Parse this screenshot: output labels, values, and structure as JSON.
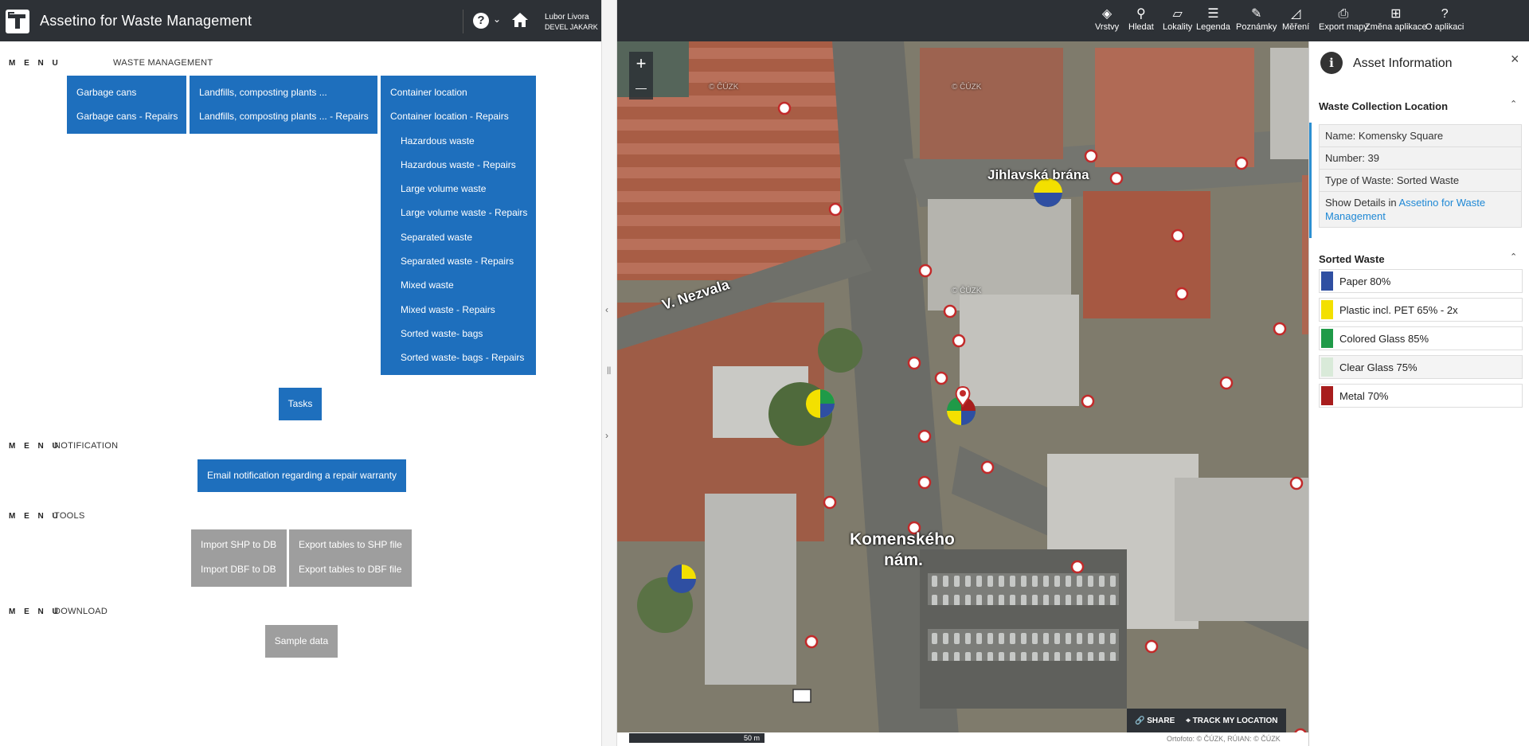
{
  "app": {
    "title": "Assetino for Waste Management",
    "user_name": "Lubor Livora",
    "user_org": "DEVEL JAKARK",
    "help_symbol": "?",
    "caret_symbol": "⌄"
  },
  "menu_tag": "M E N U",
  "sections": {
    "waste_management": {
      "label": "WASTE MANAGEMENT",
      "col1": [
        "Garbage cans",
        "Garbage cans - Repairs"
      ],
      "col2": [
        "Landfills, composting plants ...",
        "Landfills, composting plants ... - Repairs"
      ],
      "col3": [
        "Container location",
        "Container location - Repairs",
        "Hazardous waste",
        "Hazardous waste - Repairs",
        "Large volume waste",
        "Large volume waste - Repairs",
        "Separated waste",
        "Separated waste - Repairs",
        "Mixed waste",
        "Mixed waste - Repairs",
        "Sorted waste- bags",
        "Sorted waste- bags - Repairs"
      ],
      "tasks": "Tasks"
    },
    "notification": {
      "label": "NOTIFICATION",
      "email_button": "Email notification regarding a repair warranty"
    },
    "tools": {
      "label": "TOOLS",
      "col1": [
        "Import SHP to DB",
        "Import DBF to DB"
      ],
      "col2": [
        "Export tables to SHP file",
        "Export tables to DBF file"
      ]
    },
    "download": {
      "label": "DOWNLOAD",
      "sample": "Sample data"
    }
  },
  "map_toolbar": [
    {
      "label": "Vrstvy",
      "icon": "layers-icon",
      "glyph": "◈"
    },
    {
      "label": "Hledat",
      "icon": "search-icon",
      "glyph": "⚲"
    },
    {
      "label": "Lokality",
      "icon": "polygon-icon",
      "glyph": "▱"
    },
    {
      "label": "Legenda",
      "icon": "list-icon",
      "glyph": "☰"
    },
    {
      "label": "Poznámky",
      "icon": "pencil-icon",
      "glyph": "✎"
    },
    {
      "label": "Měření",
      "icon": "ruler-icon",
      "glyph": "◿"
    },
    {
      "label": "Export mapy",
      "icon": "printer-icon",
      "glyph": "⎙"
    },
    {
      "label": "Změna aplikace",
      "icon": "grid-icon",
      "glyph": "⊞"
    },
    {
      "label": "O aplikaci",
      "icon": "help-icon",
      "glyph": "?"
    }
  ],
  "map": {
    "zoom_in": "+",
    "zoom_out": "—",
    "labels": {
      "jihlavska": "Jihlavská brána",
      "nezvala": "V. Nezvala",
      "komenskeho_1": "Komenského",
      "komenskeho_2": "nám."
    },
    "watermark": "© ČÚZK",
    "scale": "50 m",
    "attribution": "Ortofoto: © ČÚZK, RÚIAN: © ČÚZK",
    "share": "SHARE",
    "track": "TRACK MY LOCATION"
  },
  "asset_panel": {
    "title": "Asset Information",
    "close": "×",
    "info_glyph": "i",
    "location_title": "Waste Collection Location",
    "name": "Name: Komensky Square",
    "number": "Number: 39",
    "type": "Type of Waste: Sorted Waste",
    "details_prefix": "Show Details in ",
    "details_link": "Assetino for Waste Management",
    "sorted_title": "Sorted Waste",
    "caret": "⌃",
    "waste_items": [
      {
        "label": "Paper 80%",
        "color": "#2f4fa2"
      },
      {
        "label": "Plastic incl. PET 65% - 2x",
        "color": "#f3e000"
      },
      {
        "label": "Colored Glass 85%",
        "color": "#1f9a48"
      },
      {
        "label": "Clear Glass 75%",
        "color": "#d9ead9"
      },
      {
        "label": "Metal 70%",
        "color": "#a81d1d"
      }
    ]
  }
}
